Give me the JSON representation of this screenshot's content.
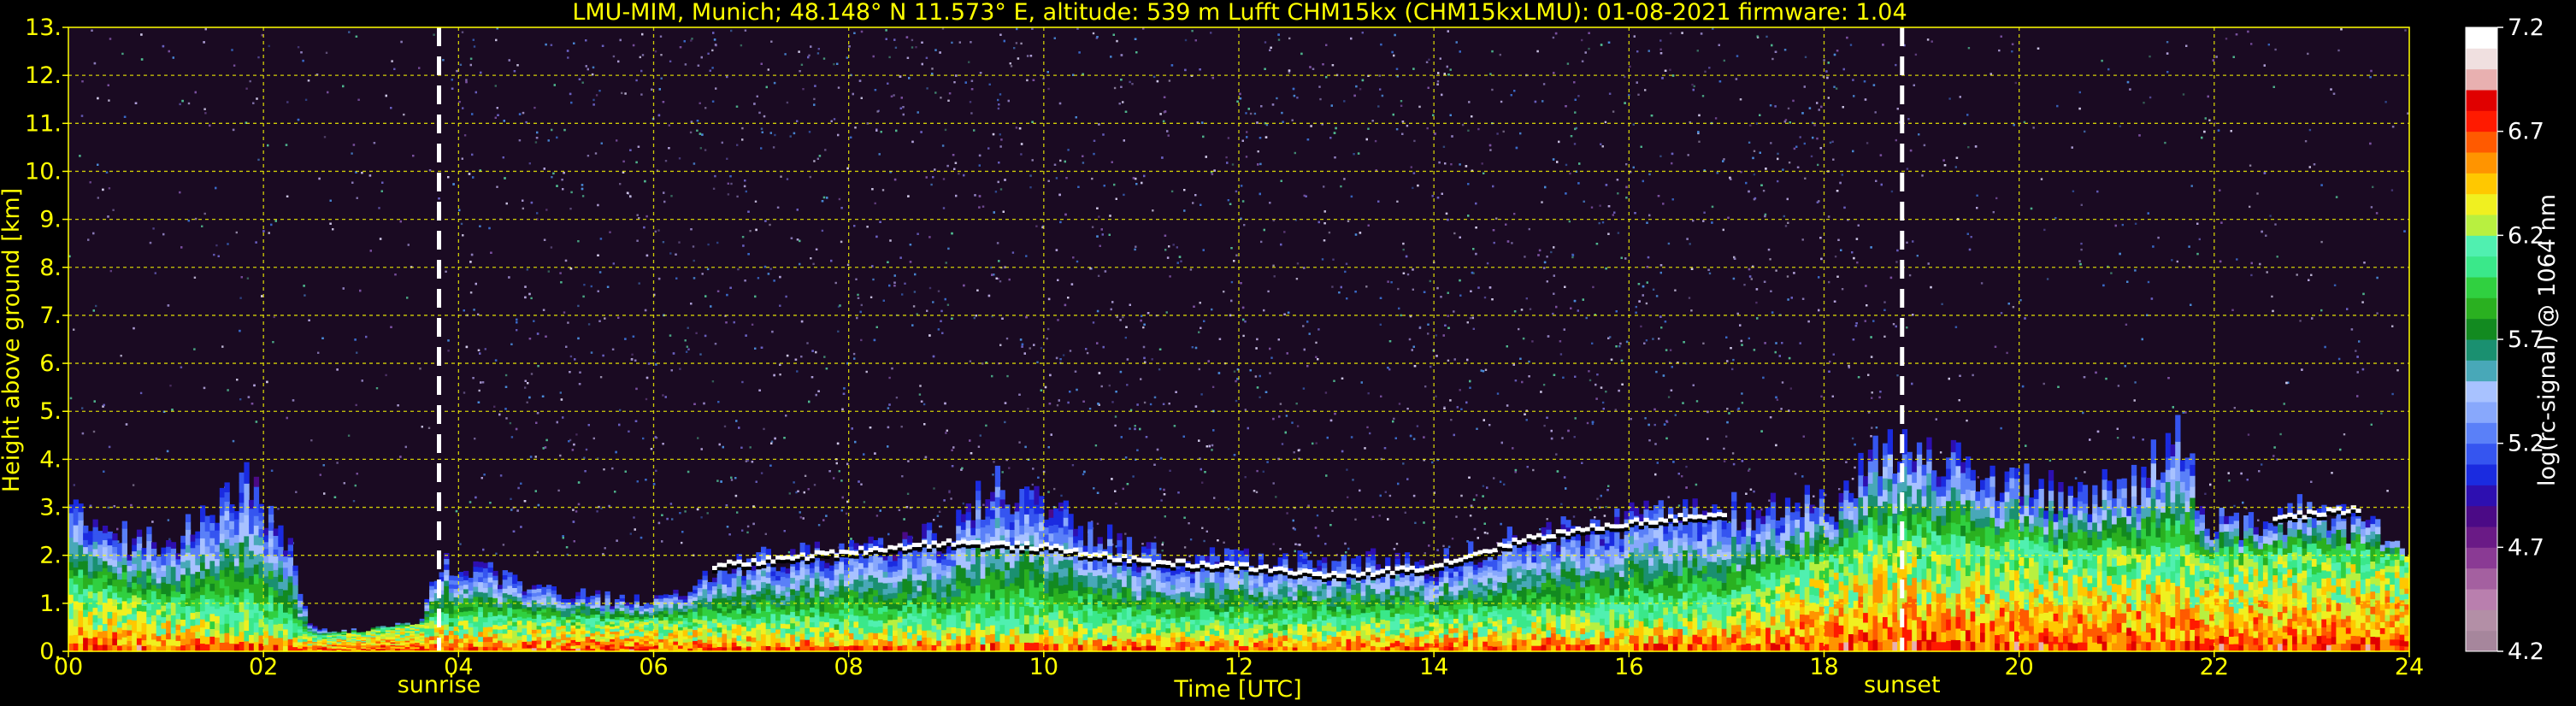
{
  "title": "LMU-MIM, Munich; 48.148° N 11.573° E, altitude: 539 m    Lufft CHM15kx (CHM15kxLMU): 01-08-2021    firmware: 1.04",
  "colors": {
    "background": "#000000",
    "text": "#ffff00",
    "grid": "#ffff00",
    "colorbar_label": "#ffffff"
  },
  "chart_data": {
    "type": "heatmap",
    "xlabel": "Time [UTC]",
    "ylabel": "Height above ground [km]",
    "xlim": [
      0,
      24
    ],
    "ylim": [
      0,
      13
    ],
    "x_ticks": [
      "00",
      "02",
      "04",
      "06",
      "08",
      "10",
      "12",
      "14",
      "16",
      "18",
      "20",
      "22",
      "24"
    ],
    "y_ticks": [
      "0.",
      "1.",
      "2.",
      "3.",
      "4.",
      "5.",
      "6.",
      "7.",
      "8.",
      "9.",
      "10.",
      "11.",
      "12.",
      "13."
    ],
    "grid": true,
    "annotations": [
      {
        "label": "sunrise",
        "x": 3.8,
        "style": "dashed-white-vertical-line"
      },
      {
        "label": "sunset",
        "x": 18.8,
        "style": "dashed-white-vertical-line"
      }
    ],
    "colorbar": {
      "label": "log(rc-signal) @ 1064 nm",
      "range": [
        4.2,
        7.2
      ],
      "ticks": [
        "7.2",
        "6.7",
        "6.2",
        "5.7",
        "5.2",
        "4.7",
        "4.2"
      ],
      "colors": [
        "#a6869c",
        "#b38fa6",
        "#b97fae",
        "#a460a0",
        "#8a3a94",
        "#6a1a86",
        "#4b0a86",
        "#2d0fb0",
        "#1a2be0",
        "#3555f0",
        "#5a80f8",
        "#88a8fc",
        "#a8c2ff",
        "#48a8b8",
        "#1a9070",
        "#128a20",
        "#2ab020",
        "#30d040",
        "#3ae88a",
        "#50f0b0",
        "#b8f040",
        "#f0f020",
        "#ffc800",
        "#ff9400",
        "#ff5a00",
        "#ff1a00",
        "#e00000",
        "#e8b0b0",
        "#f0e0e0",
        "#ffffff"
      ]
    },
    "aerosol_layer_top_km": [
      {
        "t": 0,
        "h": 2.9
      },
      {
        "t": 0.5,
        "h": 2.4
      },
      {
        "t": 1,
        "h": 2.2
      },
      {
        "t": 1.5,
        "h": 3.0
      },
      {
        "t": 1.8,
        "h": 3.5
      },
      {
        "t": 2.2,
        "h": 2.6
      },
      {
        "t": 2.5,
        "h": 0.5
      },
      {
        "t": 3.0,
        "h": 0.4
      },
      {
        "t": 3.6,
        "h": 0.6
      },
      {
        "t": 3.8,
        "h": 1.8
      },
      {
        "t": 4.2,
        "h": 1.7
      },
      {
        "t": 5,
        "h": 1.2
      },
      {
        "t": 6,
        "h": 1.0
      },
      {
        "t": 6.6,
        "h": 1.6
      },
      {
        "t": 7,
        "h": 1.9
      },
      {
        "t": 8,
        "h": 2.1
      },
      {
        "t": 9,
        "h": 2.4
      },
      {
        "t": 9.5,
        "h": 3.5
      },
      {
        "t": 10,
        "h": 3.0
      },
      {
        "t": 11,
        "h": 2.0
      },
      {
        "t": 12,
        "h": 1.9
      },
      {
        "t": 13,
        "h": 1.8
      },
      {
        "t": 13.5,
        "h": 1.9
      },
      {
        "t": 14,
        "h": 1.8
      },
      {
        "t": 15,
        "h": 2.4
      },
      {
        "t": 16,
        "h": 2.7
      },
      {
        "t": 17,
        "h": 2.9
      },
      {
        "t": 17.6,
        "h": 3.0
      },
      {
        "t": 18.2,
        "h": 3.1
      },
      {
        "t": 18.6,
        "h": 4.3
      },
      {
        "t": 19.2,
        "h": 4.1
      },
      {
        "t": 19.8,
        "h": 3.6
      },
      {
        "t": 20.5,
        "h": 3.2
      },
      {
        "t": 21.2,
        "h": 3.5
      },
      {
        "t": 21.6,
        "h": 4.5
      },
      {
        "t": 22,
        "h": 2.6
      },
      {
        "t": 22.5,
        "h": 2.8
      },
      {
        "t": 23,
        "h": 2.9
      },
      {
        "t": 24,
        "h": 2.2
      }
    ],
    "boundary_layer_km": [
      {
        "t": 0,
        "h": 1.2
      },
      {
        "t": 2.5,
        "h": 0.3
      },
      {
        "t": 3.8,
        "h": 0.6
      },
      {
        "t": 6,
        "h": 0.6
      },
      {
        "t": 9,
        "h": 0.5
      },
      {
        "t": 12,
        "h": 0.5
      },
      {
        "t": 14,
        "h": 0.6
      },
      {
        "t": 16,
        "h": 0.7
      },
      {
        "t": 17,
        "h": 0.9
      },
      {
        "t": 18.5,
        "h": 2.2
      },
      {
        "t": 20,
        "h": 2.0
      },
      {
        "t": 22,
        "h": 1.9
      },
      {
        "t": 24,
        "h": 2.0
      }
    ],
    "cloud_base_km": [
      {
        "t": 6.6,
        "h": 1.7
      },
      {
        "t": 8,
        "h": 2.0
      },
      {
        "t": 9,
        "h": 2.2
      },
      {
        "t": 10,
        "h": 2.1
      },
      {
        "t": 11,
        "h": 1.8
      },
      {
        "t": 12,
        "h": 1.7
      },
      {
        "t": 13,
        "h": 1.5
      },
      {
        "t": 14,
        "h": 1.7
      },
      {
        "t": 15,
        "h": 2.3
      },
      {
        "t": 16,
        "h": 2.6
      },
      {
        "t": 17,
        "h": 2.8
      },
      {
        "t": 22.6,
        "h": 2.7
      },
      {
        "t": 23.5,
        "h": 2.9
      }
    ]
  }
}
